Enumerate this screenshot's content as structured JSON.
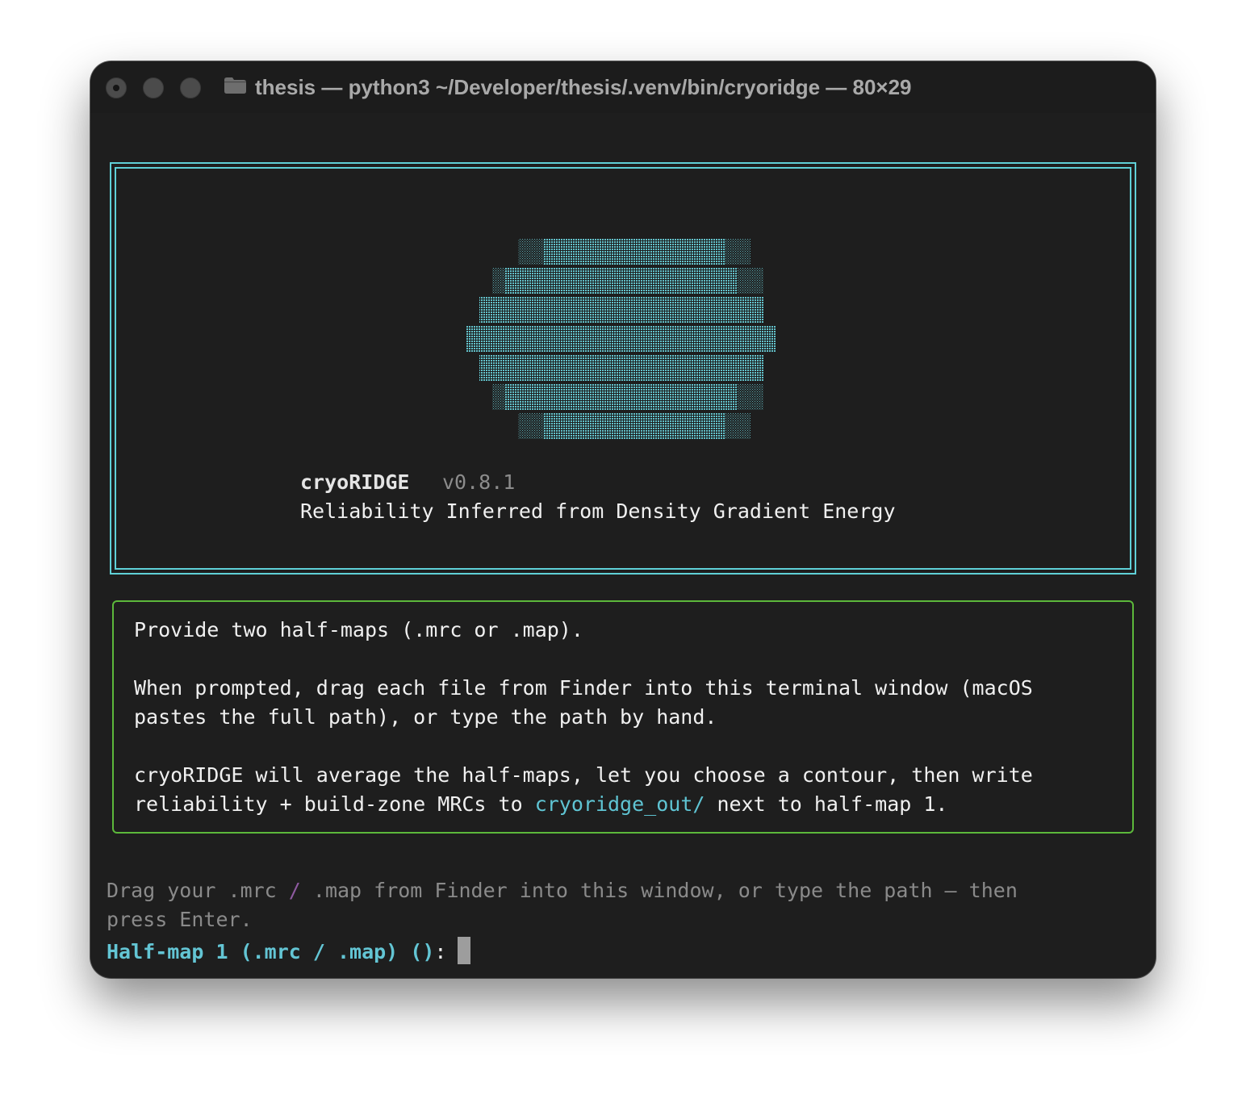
{
  "window": {
    "title": "thesis — python3 ~/Developer/thesis/.venv/bin/cryoridge — 80×29"
  },
  "banner": {
    "app_name": "cryoRIDGE",
    "version": "v0.8.1",
    "tagline": "Reliability Inferred from Density Gradient Energy"
  },
  "info": {
    "line1": "Provide two half-maps (.mrc or .map).",
    "line2": "When prompted, drag each file from Finder into this terminal window (macOS",
    "line3": "pastes the full path), or type the path by hand.",
    "line4": "cryoRIDGE will average the half-maps, let you choose a contour, then write",
    "line5_before": "reliability + build-zone MRCs to ",
    "line5_link": "cryoridge_out/",
    "line5_after": " next to half-map 1."
  },
  "hint": {
    "line1_a": "Drag your .mrc ",
    "line1_slash": "/",
    "line1_b": " .map from Finder into this window, or type the path — then",
    "line2": "press Enter."
  },
  "prompt": {
    "label": "Half-map 1 (.mrc / .map) ()",
    "colon": ":"
  },
  "colors": {
    "banner_border": "#5fd0d7",
    "info_border": "#5cb83b",
    "accent": "#5fc4d3",
    "background": "#1e1e1e"
  }
}
